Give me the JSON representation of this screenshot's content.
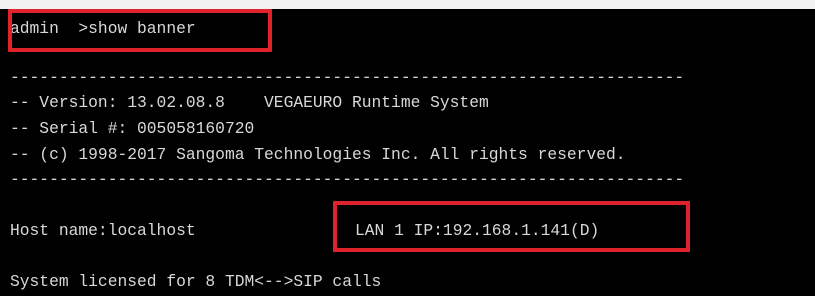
{
  "terminal": {
    "command_line": "admin  >show banner",
    "separator_top": "---------------------------------------------------------------------",
    "version_line": "-- Version: 13.02.08.8    VEGAEURO Runtime System",
    "serial_line": "-- Serial #: 005058160720",
    "copyright_line": "-- (c) 1998-2017 Sangoma Technologies Inc. All rights reserved.",
    "separator_bottom": "---------------------------------------------------------------------",
    "host_name": "Host name:localhost",
    "lan_ip": "LAN 1 IP:192.168.1.141(D)",
    "license_line": "System licensed for 8 TDM<-->SIP calls"
  },
  "colors": {
    "background": "#000000",
    "text": "#d8d8d8",
    "highlight": "#e0232b"
  }
}
